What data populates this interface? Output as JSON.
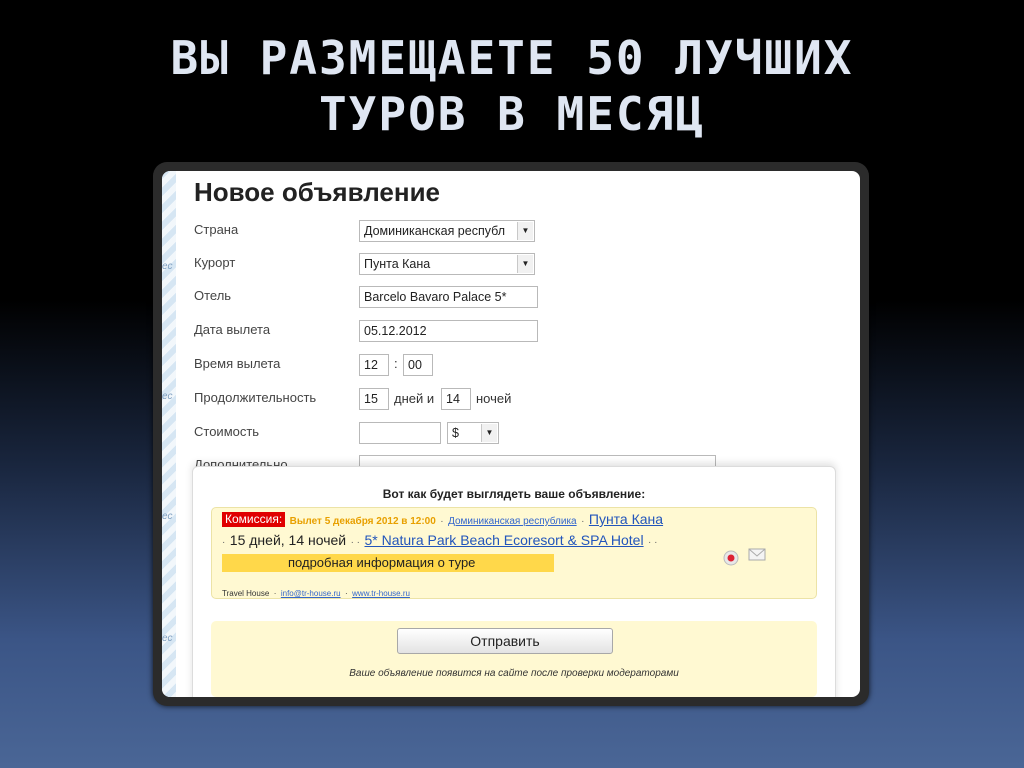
{
  "slide": {
    "title_line1": "ВЫ РАЗМЕЩАЕТЕ 50 ЛУЧШИХ",
    "title_line2": "ТУРОВ В МЕСЯЦ"
  },
  "form": {
    "title": "Новое объявление",
    "country": {
      "label": "Страна",
      "value": "Доминиканская республ"
    },
    "resort": {
      "label": "Курорт",
      "value": "Пунта Кана"
    },
    "hotel": {
      "label": "Отель",
      "value": "Barcelo Bavaro Palace 5*"
    },
    "departure_date": {
      "label": "Дата вылета",
      "value": "05.12.2012"
    },
    "departure_time": {
      "label": "Время вылета",
      "hours": "12",
      "separator": ":",
      "minutes": "00"
    },
    "duration": {
      "label": "Продолжительность",
      "days": "15",
      "days_word": "дней и",
      "nights": "14",
      "nights_word": "ночей"
    },
    "price": {
      "label": "Стоимость",
      "value": "",
      "currency": "$"
    },
    "extra": {
      "label": "Дополнительно"
    }
  },
  "preview": {
    "heading": "Вот как будет выглядеть ваше объявление:",
    "badge": "Комиссия:",
    "departure": "Вылет 5 декабря 2012 в 12:00",
    "sep": "·",
    "country_link": "Доминиканская республика",
    "resort_link": "Пунта Кана",
    "duration": "15 дней, 14 ночей",
    "sep_double": "· ·",
    "hotel_link": "5* Natura Park Beach Ecoresort & SPA Hotel",
    "info": "подробная информация о туре",
    "agency": "Travel House",
    "email": "info@tr-house.ru",
    "site": "www.tr-house.ru"
  },
  "submit": {
    "button": "Отправить",
    "note": "Ваше объявление появится на сайте после проверки модераторами"
  },
  "colors": {
    "badge": "#e00000",
    "date": "#e8a000",
    "info_bar": "#ffd84a",
    "panel": "#fff9d2"
  }
}
